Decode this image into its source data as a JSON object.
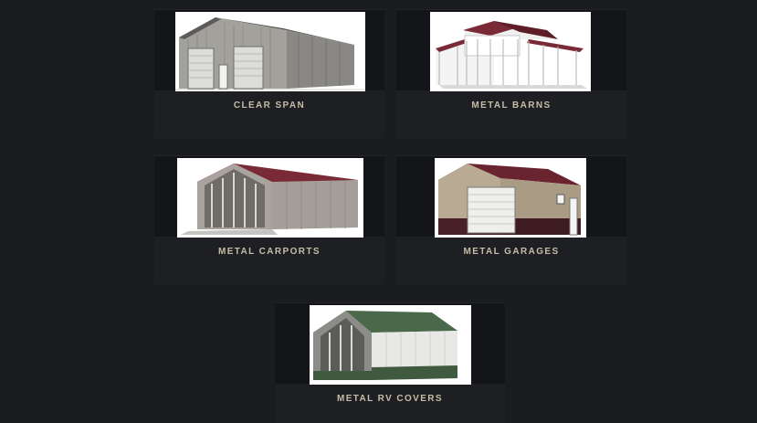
{
  "cards": [
    {
      "label": "CLEAR SPAN",
      "image": "clear-span-building"
    },
    {
      "label": "METAL BARNS",
      "image": "metal-barn-building"
    },
    {
      "label": "METAL CARPORTS",
      "image": "metal-carport-building"
    },
    {
      "label": "METAL GARAGES",
      "image": "metal-garage-building"
    },
    {
      "label": "METAL RV COVERS",
      "image": "metal-rv-cover-building"
    }
  ],
  "colors": {
    "background": "#1b1c1e",
    "card": "#1e1f22",
    "label": "#c6bda8",
    "roof_red": "#7a2a36",
    "roof_green": "#3f5a3f"
  }
}
